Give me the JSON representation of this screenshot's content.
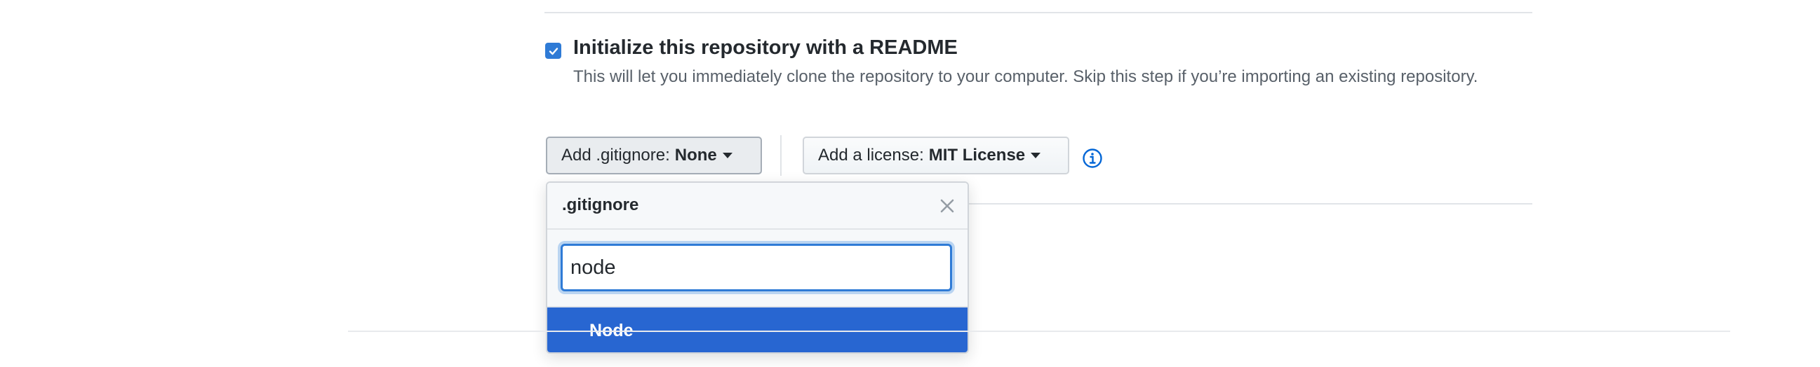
{
  "readme": {
    "checked": true,
    "title": "Initialize this repository with a README",
    "description": "This will let you immediately clone the repository to your computer. Skip this step if you’re importing an existing repository."
  },
  "gitignore_button": {
    "label": "Add .gitignore:",
    "value": "None"
  },
  "license_button": {
    "label": "Add a license:",
    "value": "MIT License"
  },
  "gitignore_popover": {
    "title": ".gitignore",
    "filter_value": "node",
    "results": [
      "Node"
    ]
  },
  "colors": {
    "accent": "#2866d1",
    "checkbox": "#2f7bd6",
    "info_icon": "#0366d6"
  },
  "icons": [
    "check-icon",
    "caret-down-icon",
    "info-icon",
    "close-icon"
  ]
}
